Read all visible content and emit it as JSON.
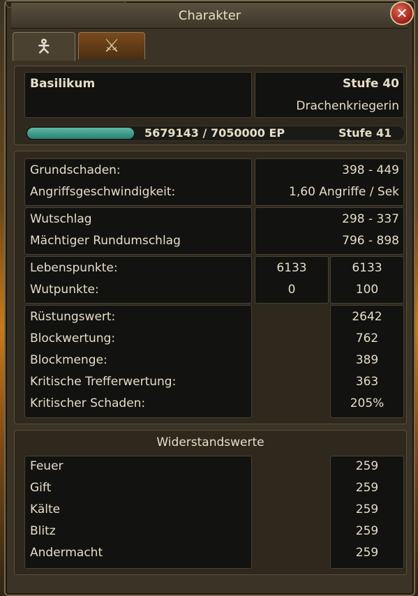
{
  "window": {
    "title": "Charakter"
  },
  "tabs": [
    {
      "icon": "person-icon"
    },
    {
      "icon": "crossed-swords-icon"
    }
  ],
  "header": {
    "name": "Basilikum",
    "level": "Stufe 40",
    "class": "Drachenkriegerin"
  },
  "xp": {
    "current": "5679143",
    "separator": "/",
    "max": "7050000",
    "unit": "EP",
    "next_level": "Stufe 41",
    "progress": 0.806
  },
  "damage": [
    {
      "label": "Grundschaden:",
      "value": "398 - 449"
    },
    {
      "label": "Angriffsgeschwindigkeit:",
      "value": "1,60 Angriffe / Sek"
    }
  ],
  "skills": [
    {
      "label": "Wutschlag",
      "value": "298 - 337"
    },
    {
      "label": "Mächtiger Rundumschlag",
      "value": "796 - 898"
    }
  ],
  "resources": [
    {
      "label": "Lebenspunkte:",
      "current": "6133",
      "max": "6133"
    },
    {
      "label": "Wutpunkte:",
      "current": "0",
      "max": "100"
    }
  ],
  "defense": [
    {
      "label": "Rüstungswert:",
      "value": "2642"
    },
    {
      "label": "Blockwertung:",
      "value": "762"
    },
    {
      "label": "Blockmenge:",
      "value": "389"
    },
    {
      "label": "Kritische Trefferwertung:",
      "value": "363"
    },
    {
      "label": "Kritischer Schaden:",
      "value": "205%"
    }
  ],
  "resistances": {
    "heading": "Widerstandswerte",
    "rows": [
      {
        "label": "Feuer",
        "value": "259"
      },
      {
        "label": "Gift",
        "value": "259"
      },
      {
        "label": "Kälte",
        "value": "259"
      },
      {
        "label": "Blitz",
        "value": "259"
      },
      {
        "label": "Andermacht",
        "value": "259"
      }
    ]
  }
}
